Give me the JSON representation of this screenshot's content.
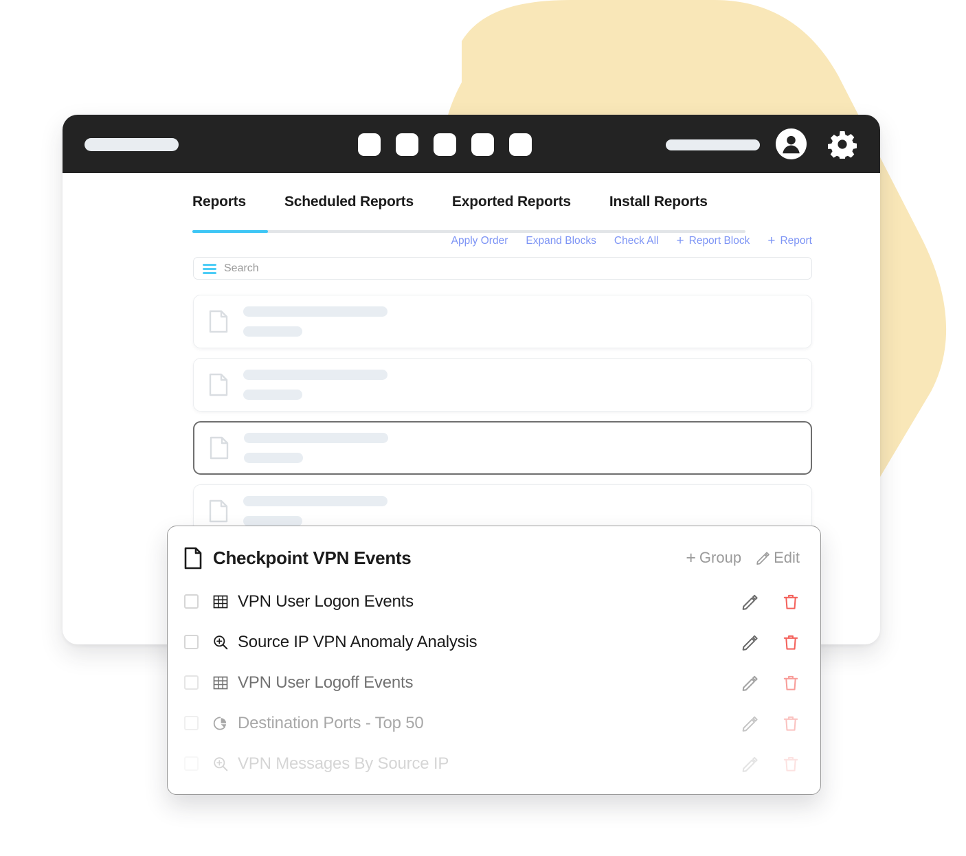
{
  "theme": {
    "blob_color": "#f9e7b8",
    "titlebar_bg": "#232323",
    "accent_cyan": "#3ec6f5",
    "link_blue": "#7d94f5",
    "trash_red": "#f4625c",
    "pencil_gray": "#6b6b6b",
    "skeleton_gray": "#e8edf2"
  },
  "titlebar": {
    "left_pill": "address-pill",
    "tab_squares": [
      "tab-1",
      "tab-2",
      "tab-3",
      "tab-4",
      "tab-5"
    ],
    "right_pill": "url-pill",
    "avatar_icon": "user-avatar-icon",
    "settings_icon": "gear-icon"
  },
  "tabs": {
    "items": [
      {
        "label": "Reports",
        "active": true
      },
      {
        "label": "Scheduled Reports",
        "active": false
      },
      {
        "label": "Exported Reports",
        "active": false
      },
      {
        "label": "Install Reports",
        "active": false
      }
    ]
  },
  "actions": [
    {
      "label": "Apply Order",
      "plus": false
    },
    {
      "label": "Expand Blocks",
      "plus": false
    },
    {
      "label": "Check All",
      "plus": false
    },
    {
      "label": "Report Block",
      "plus": true
    },
    {
      "label": "Report",
      "plus": true
    }
  ],
  "search": {
    "placeholder": "Search",
    "value": "",
    "icon": "filter-lines-icon"
  },
  "report_list": {
    "rows": [
      {
        "icon": "document-icon",
        "selected": false
      },
      {
        "icon": "document-icon",
        "selected": false
      },
      {
        "icon": "document-icon",
        "selected": true
      },
      {
        "icon": "document-icon",
        "selected": false
      }
    ]
  },
  "card": {
    "icon": "document-icon",
    "title": "Checkpoint VPN Events",
    "head_actions": [
      {
        "label": "Group",
        "icon": "plus-icon"
      },
      {
        "label": "Edit",
        "icon": "pencil-icon"
      }
    ],
    "items": [
      {
        "label": "VPN User Logon Events",
        "icon": "table-grid-icon",
        "checked": false,
        "opacity": "1"
      },
      {
        "label": "Source IP VPN Anomaly Analysis",
        "icon": "magnify-plus-icon",
        "checked": false,
        "opacity": "1"
      },
      {
        "label": "VPN User Logoff Events",
        "icon": "table-grid-icon",
        "checked": false,
        "opacity": "0.62"
      },
      {
        "label": "Destination Ports - Top 50",
        "icon": "pie-chart-icon",
        "checked": false,
        "opacity": "0.38"
      },
      {
        "label": "VPN Messages By Source IP",
        "icon": "magnify-plus-icon",
        "checked": false,
        "opacity": "0.18"
      }
    ],
    "row_tools": [
      {
        "icon": "pencil-icon"
      },
      {
        "icon": "trash-icon"
      }
    ]
  }
}
